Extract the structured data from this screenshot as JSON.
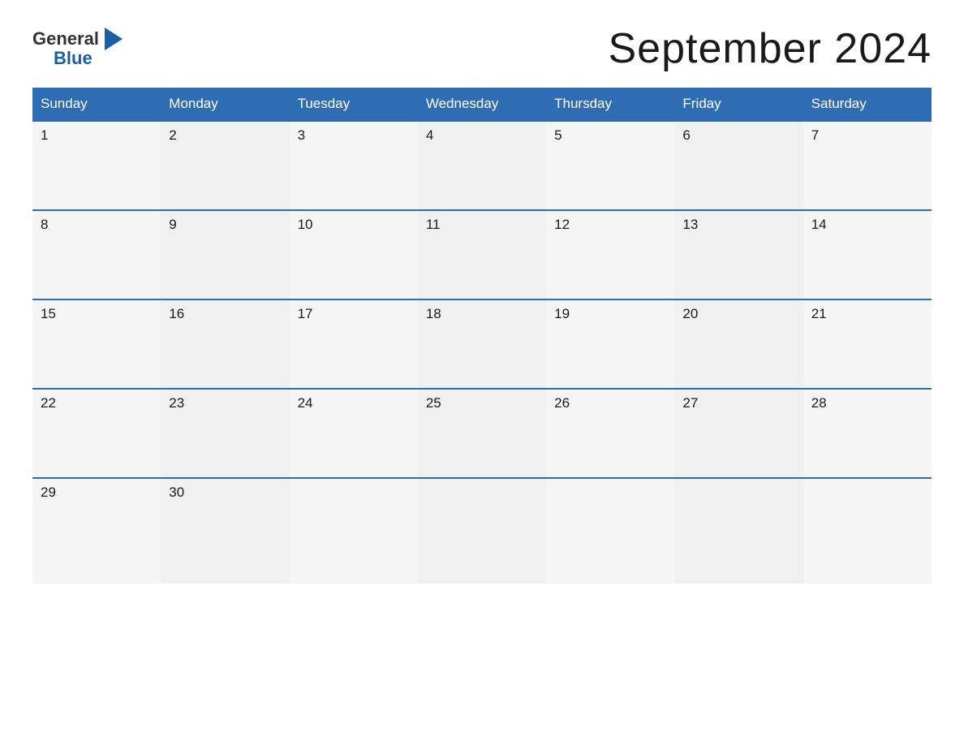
{
  "logo": {
    "general": "General",
    "blue": "Blue"
  },
  "title": "September 2024",
  "weekdays": [
    "Sunday",
    "Monday",
    "Tuesday",
    "Wednesday",
    "Thursday",
    "Friday",
    "Saturday"
  ],
  "weeks": [
    [
      {
        "day": "1"
      },
      {
        "day": "2"
      },
      {
        "day": "3"
      },
      {
        "day": "4"
      },
      {
        "day": "5"
      },
      {
        "day": "6"
      },
      {
        "day": "7"
      }
    ],
    [
      {
        "day": "8"
      },
      {
        "day": "9"
      },
      {
        "day": "10"
      },
      {
        "day": "11"
      },
      {
        "day": "12"
      },
      {
        "day": "13"
      },
      {
        "day": "14"
      }
    ],
    [
      {
        "day": "15"
      },
      {
        "day": "16"
      },
      {
        "day": "17"
      },
      {
        "day": "18"
      },
      {
        "day": "19"
      },
      {
        "day": "20"
      },
      {
        "day": "21"
      }
    ],
    [
      {
        "day": "22"
      },
      {
        "day": "23"
      },
      {
        "day": "24"
      },
      {
        "day": "25"
      },
      {
        "day": "26"
      },
      {
        "day": "27"
      },
      {
        "day": "28"
      }
    ],
    [
      {
        "day": "29"
      },
      {
        "day": "30"
      },
      {
        "day": ""
      },
      {
        "day": ""
      },
      {
        "day": ""
      },
      {
        "day": ""
      },
      {
        "day": ""
      }
    ]
  ]
}
